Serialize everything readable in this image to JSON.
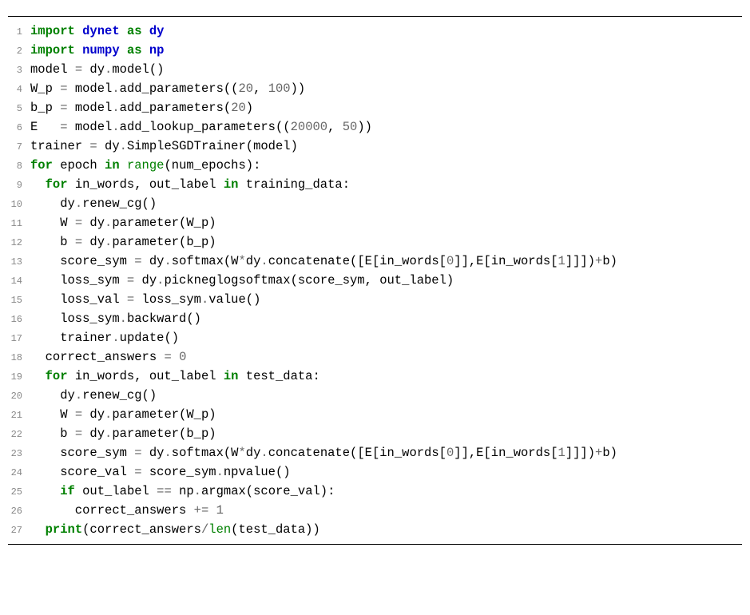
{
  "code": {
    "lines": [
      {
        "n": "1",
        "html": "<span class='kw'>import</span> <span class='cls'>dynet</span> <span class='kw'>as</span> <span class='cls'>dy</span>"
      },
      {
        "n": "2",
        "html": "<span class='kw'>import</span> <span class='cls'>numpy</span> <span class='kw'>as</span> <span class='cls'>np</span>"
      },
      {
        "n": "3",
        "html": "model <span class='op'>=</span> dy<span class='op'>.</span>model()"
      },
      {
        "n": "4",
        "html": "W_p <span class='op'>=</span> model<span class='op'>.</span>add_parameters((<span class='num'>20</span>, <span class='num'>100</span>))"
      },
      {
        "n": "5",
        "html": "b_p <span class='op'>=</span> model<span class='op'>.</span>add_parameters(<span class='num'>20</span>)"
      },
      {
        "n": "6",
        "html": "E   <span class='op'>=</span> model<span class='op'>.</span>add_lookup_parameters((<span class='num'>20000</span>, <span class='num'>50</span>))"
      },
      {
        "n": "7",
        "html": "trainer <span class='op'>=</span> dy<span class='op'>.</span>SimpleSGDTrainer(model)"
      },
      {
        "n": "8",
        "html": "<span class='kw'>for</span> epoch <span class='kw'>in</span> <span class='builtin'>range</span>(num_epochs):"
      },
      {
        "n": "9",
        "html": "  <span class='kw'>for</span> in_words, out_label <span class='kw'>in</span> training_data:"
      },
      {
        "n": "10",
        "html": "    dy<span class='op'>.</span>renew_cg()"
      },
      {
        "n": "11",
        "html": "    W <span class='op'>=</span> dy<span class='op'>.</span>parameter(W_p)"
      },
      {
        "n": "12",
        "html": "    b <span class='op'>=</span> dy<span class='op'>.</span>parameter(b_p)"
      },
      {
        "n": "13",
        "html": "    score_sym <span class='op'>=</span> dy<span class='op'>.</span>softmax(W<span class='op'>*</span>dy<span class='op'>.</span>concatenate([E[in_words[<span class='num'>0</span>]],E[in_words[<span class='num'>1</span>]]])<span class='op'>+</span>b)"
      },
      {
        "n": "14",
        "html": "    loss_sym <span class='op'>=</span> dy<span class='op'>.</span>pickneglogsoftmax(score_sym, out_label)"
      },
      {
        "n": "15",
        "html": "    loss_val <span class='op'>=</span> loss_sym<span class='op'>.</span>value()"
      },
      {
        "n": "16",
        "html": "    loss_sym<span class='op'>.</span>backward()"
      },
      {
        "n": "17",
        "html": "    trainer<span class='op'>.</span>update()"
      },
      {
        "n": "18",
        "html": "  correct_answers <span class='op'>=</span> <span class='num'>0</span>"
      },
      {
        "n": "19",
        "html": "  <span class='kw'>for</span> in_words, out_label <span class='kw'>in</span> test_data:"
      },
      {
        "n": "20",
        "html": "    dy<span class='op'>.</span>renew_cg()"
      },
      {
        "n": "21",
        "html": "    W <span class='op'>=</span> dy<span class='op'>.</span>parameter(W_p)"
      },
      {
        "n": "22",
        "html": "    b <span class='op'>=</span> dy<span class='op'>.</span>parameter(b_p)"
      },
      {
        "n": "23",
        "html": "    score_sym <span class='op'>=</span> dy<span class='op'>.</span>softmax(W<span class='op'>*</span>dy<span class='op'>.</span>concatenate([E[in_words[<span class='num'>0</span>]],E[in_words[<span class='num'>1</span>]]])<span class='op'>+</span>b)"
      },
      {
        "n": "24",
        "html": "    score_val <span class='op'>=</span> score_sym<span class='op'>.</span>npvalue()"
      },
      {
        "n": "25",
        "html": "    <span class='kw'>if</span> out_label <span class='op'>==</span> np<span class='op'>.</span>argmax(score_val):"
      },
      {
        "n": "26",
        "html": "      correct_answers <span class='op'>+=</span> <span class='num'>1</span>"
      },
      {
        "n": "27",
        "html": "  <span class='kw'>print</span>(correct_answers<span class='op'>/</span><span class='builtin'>len</span>(test_data))"
      }
    ]
  }
}
